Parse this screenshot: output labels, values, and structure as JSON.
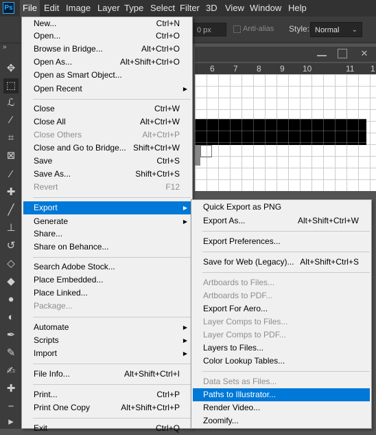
{
  "app": {
    "logo": "Ps"
  },
  "menubar": [
    "File",
    "Edit",
    "Image",
    "Layer",
    "Type",
    "Select",
    "Filter",
    "3D",
    "View",
    "Window",
    "Help"
  ],
  "options_bar": {
    "feather_value": "0 px",
    "anti_alias_label": "Anti-alias",
    "style_label": "Style:",
    "style_value": "Normal"
  },
  "tools": [
    "move-icon",
    "marquee-icon",
    "lasso-icon",
    "magic-wand-icon",
    "crop-icon",
    "frame-icon",
    "eyedropper-icon",
    "healing-brush-icon",
    "brush-icon",
    "clone-stamp-icon",
    "history-brush-icon",
    "eraser-icon",
    "paint-bucket-icon",
    "blur-icon",
    "dodge-icon",
    "pen-icon",
    "freeform-pen-icon",
    "curvature-pen-icon",
    "add-anchor-icon",
    "delete-anchor-icon",
    "path-select-icon"
  ],
  "ruler": [
    "6",
    "7",
    "8",
    "9",
    "10",
    "11",
    "1"
  ],
  "file_menu": [
    {
      "label": "New...",
      "shortcut": "Ctrl+N"
    },
    {
      "label": "Open...",
      "shortcut": "Ctrl+O"
    },
    {
      "label": "Browse in Bridge...",
      "shortcut": "Alt+Ctrl+O"
    },
    {
      "label": "Open As...",
      "shortcut": "Alt+Shift+Ctrl+O"
    },
    {
      "label": "Open as Smart Object...",
      "shortcut": ""
    },
    {
      "label": "Open Recent",
      "shortcut": "",
      "submenu": true
    },
    {
      "label": "Close",
      "shortcut": "Ctrl+W"
    },
    {
      "label": "Close All",
      "shortcut": "Alt+Ctrl+W"
    },
    {
      "label": "Close Others",
      "shortcut": "Alt+Ctrl+P",
      "disabled": true
    },
    {
      "label": "Close and Go to Bridge...",
      "shortcut": "Shift+Ctrl+W"
    },
    {
      "label": "Save",
      "shortcut": "Ctrl+S"
    },
    {
      "label": "Save As...",
      "shortcut": "Shift+Ctrl+S"
    },
    {
      "label": "Revert",
      "shortcut": "F12",
      "disabled": true
    },
    {
      "label": "Export",
      "shortcut": "",
      "submenu": true,
      "highlighted": true
    },
    {
      "label": "Generate",
      "shortcut": "",
      "submenu": true
    },
    {
      "label": "Share...",
      "shortcut": ""
    },
    {
      "label": "Share on Behance...",
      "shortcut": ""
    },
    {
      "label": "Search Adobe Stock...",
      "shortcut": ""
    },
    {
      "label": "Place Embedded...",
      "shortcut": ""
    },
    {
      "label": "Place Linked...",
      "shortcut": ""
    },
    {
      "label": "Package...",
      "shortcut": "",
      "disabled": true
    },
    {
      "label": "Automate",
      "shortcut": "",
      "submenu": true
    },
    {
      "label": "Scripts",
      "shortcut": "",
      "submenu": true
    },
    {
      "label": "Import",
      "shortcut": "",
      "submenu": true
    },
    {
      "label": "File Info...",
      "shortcut": "Alt+Shift+Ctrl+I"
    },
    {
      "label": "Print...",
      "shortcut": "Ctrl+P"
    },
    {
      "label": "Print One Copy",
      "shortcut": "Alt+Shift+Ctrl+P"
    },
    {
      "label": "Exit",
      "shortcut": "Ctrl+Q"
    }
  ],
  "export_menu": [
    {
      "label": "Quick Export as PNG",
      "shortcut": ""
    },
    {
      "label": "Export As...",
      "shortcut": "Alt+Shift+Ctrl+W"
    },
    {
      "label": "Export Preferences...",
      "shortcut": ""
    },
    {
      "label": "Save for Web (Legacy)...",
      "shortcut": "Alt+Shift+Ctrl+S"
    },
    {
      "label": "Artboards to Files...",
      "shortcut": "",
      "disabled": true
    },
    {
      "label": "Artboards to PDF...",
      "shortcut": "",
      "disabled": true
    },
    {
      "label": "Export For Aero...",
      "shortcut": ""
    },
    {
      "label": "Layer Comps to Files...",
      "shortcut": "",
      "disabled": true
    },
    {
      "label": "Layer Comps to PDF...",
      "shortcut": "",
      "disabled": true
    },
    {
      "label": "Layers to Files...",
      "shortcut": ""
    },
    {
      "label": "Color Lookup Tables...",
      "shortcut": ""
    },
    {
      "label": "Data Sets as Files...",
      "shortcut": "",
      "disabled": true
    },
    {
      "label": "Paths to Illustrator...",
      "shortcut": "",
      "highlighted": true
    },
    {
      "label": "Render Video...",
      "shortcut": ""
    },
    {
      "label": "Zoomify...",
      "shortcut": ""
    }
  ],
  "colors": {
    "accent": "#0078d7",
    "menu_bg": "#f0f0f0",
    "app_bg": "#535353",
    "bar_bg": "#323232",
    "disabled": "#8d8d8d"
  }
}
